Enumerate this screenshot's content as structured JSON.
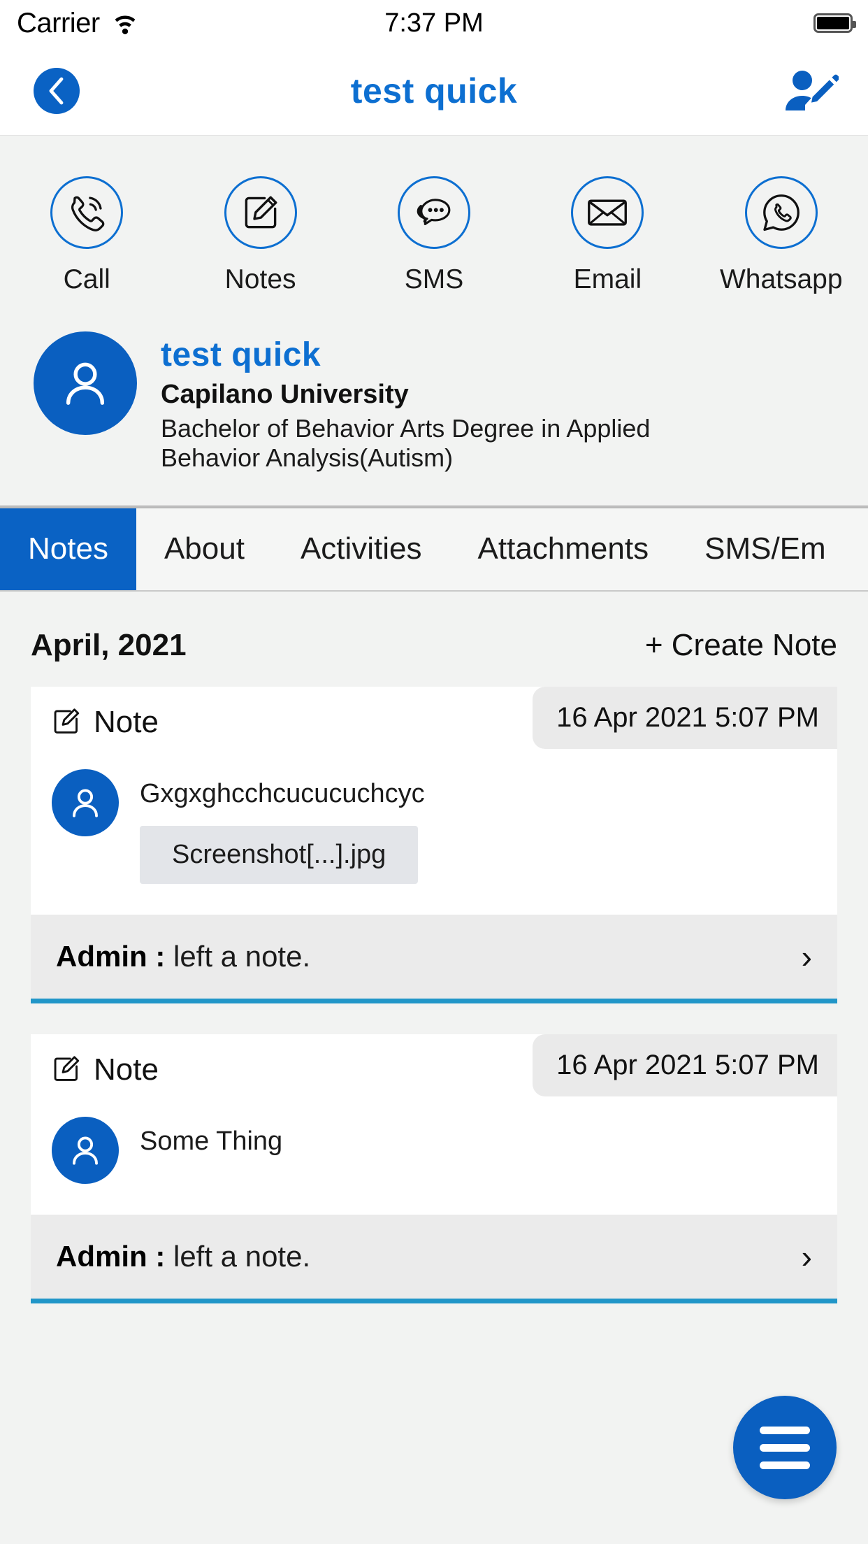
{
  "status_bar": {
    "carrier": "Carrier",
    "wifi_icon": "wifi-icon",
    "time": "7:37 PM",
    "battery_icon": "battery-full-icon"
  },
  "nav": {
    "back_icon": "chevron-left-icon",
    "title": "test  quick",
    "edit_contact_icon": "user-edit-icon"
  },
  "quick_actions": [
    {
      "label": "Call",
      "icon": "phone-call-icon"
    },
    {
      "label": "Notes",
      "icon": "pencil-square-icon"
    },
    {
      "label": "SMS",
      "icon": "chat-bubbles-icon"
    },
    {
      "label": "Email",
      "icon": "envelope-icon"
    },
    {
      "label": "Whatsapp",
      "icon": "whatsapp-icon"
    }
  ],
  "profile": {
    "avatar_icon": "person-avatar-icon",
    "name": "test  quick",
    "organization": "Capilano University",
    "degree": "Bachelor of Behavior Arts Degree in Applied Behavior Analysis(Autism)"
  },
  "tabs": [
    {
      "label": "Notes",
      "active": true
    },
    {
      "label": "About",
      "active": false
    },
    {
      "label": "Activities",
      "active": false
    },
    {
      "label": "Attachments",
      "active": false
    },
    {
      "label": "SMS/Em",
      "active": false
    }
  ],
  "notes_panel": {
    "month": "April, 2021",
    "create_note_label": "+ Create Note",
    "notes": [
      {
        "type_label": "Note",
        "type_icon": "note-edit-icon",
        "date": "16 Apr 2021 5:07 PM",
        "avatar_icon": "person-avatar-icon",
        "text": "Gxgxghcchcucucuchcyc",
        "attachment": "Screenshot[...].jpg",
        "footer_author": "Admin",
        "footer_separator": " : ",
        "footer_action": "left a note.",
        "chevron_icon": "chevron-right-icon"
      },
      {
        "type_label": "Note",
        "type_icon": "note-edit-icon",
        "date": "16 Apr 2021 5:07 PM",
        "avatar_icon": "person-avatar-icon",
        "text": "Some Thing",
        "attachment": null,
        "footer_author": "Admin",
        "footer_separator": " : ",
        "footer_action": "left a note.",
        "chevron_icon": "chevron-right-icon"
      }
    ]
  },
  "fab": {
    "icon": "hamburger-menu-icon"
  },
  "colors": {
    "primary_blue": "#0a62c4",
    "title_blue": "#0d6fd1",
    "accent_underline": "#2196c8",
    "page_bg": "#f2f3f2"
  }
}
